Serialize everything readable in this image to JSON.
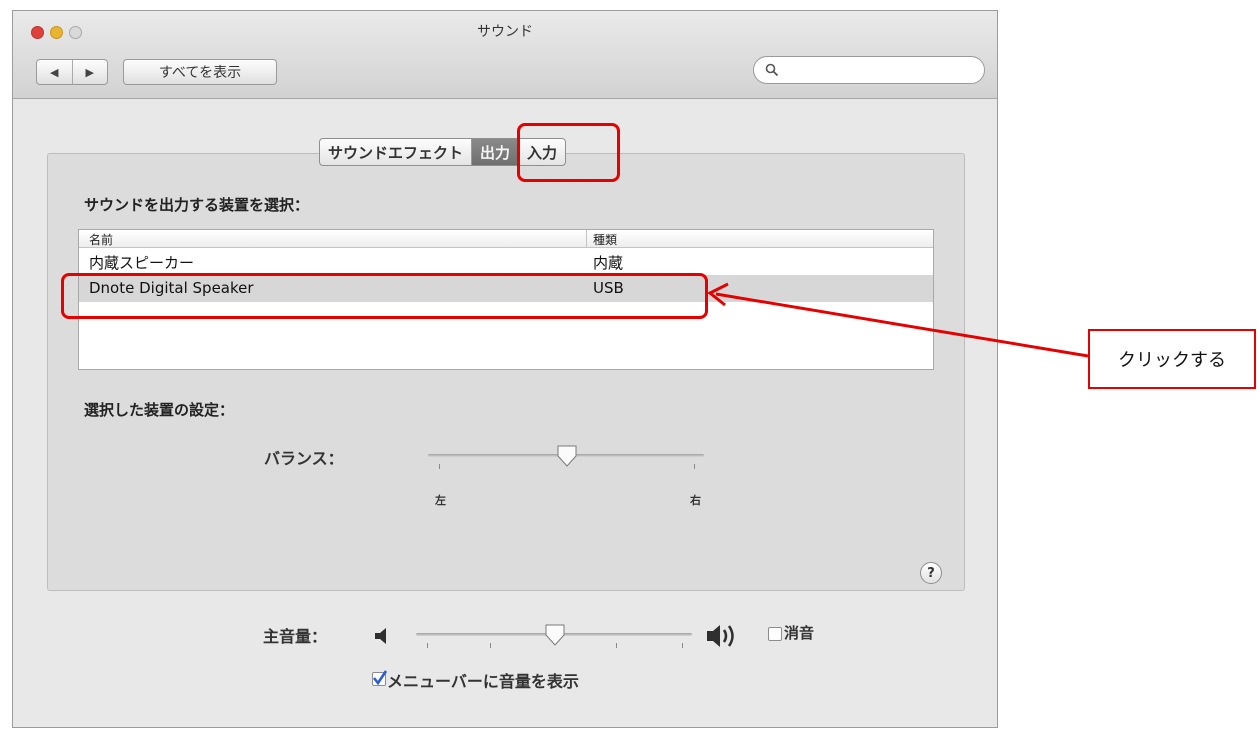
{
  "window": {
    "title": "サウンド",
    "nav": {
      "back": "◀",
      "forward": "▶"
    },
    "show_all": "すべてを表示",
    "search_placeholder": ""
  },
  "tabs": [
    {
      "label": "サウンドエフェクト",
      "selected": false
    },
    {
      "label": "出力",
      "selected": true
    },
    {
      "label": "入力",
      "selected": false
    }
  ],
  "output": {
    "heading": "サウンドを出力する装置を選択：",
    "columns": {
      "name": "名前",
      "type": "種類"
    },
    "devices": [
      {
        "name": "内蔵スピーカー",
        "type": "内蔵",
        "selected": false
      },
      {
        "name": "Dnote Digital Speaker",
        "type": "USB",
        "selected": true
      }
    ]
  },
  "device_settings": {
    "heading": "選択した装置の設定：",
    "balance_label": "バランス：",
    "balance_left": "左",
    "balance_right": "右",
    "balance_value": 0.5
  },
  "help": "?",
  "volume": {
    "label": "主音量：",
    "value": 0.5,
    "mute_label": "消音",
    "mute_checked": false,
    "show_in_menubar_label": "メニューバーに音量を表示",
    "show_in_menubar_checked": true
  },
  "annotation": {
    "callout_text": "クリックする",
    "color": "#e60000"
  }
}
